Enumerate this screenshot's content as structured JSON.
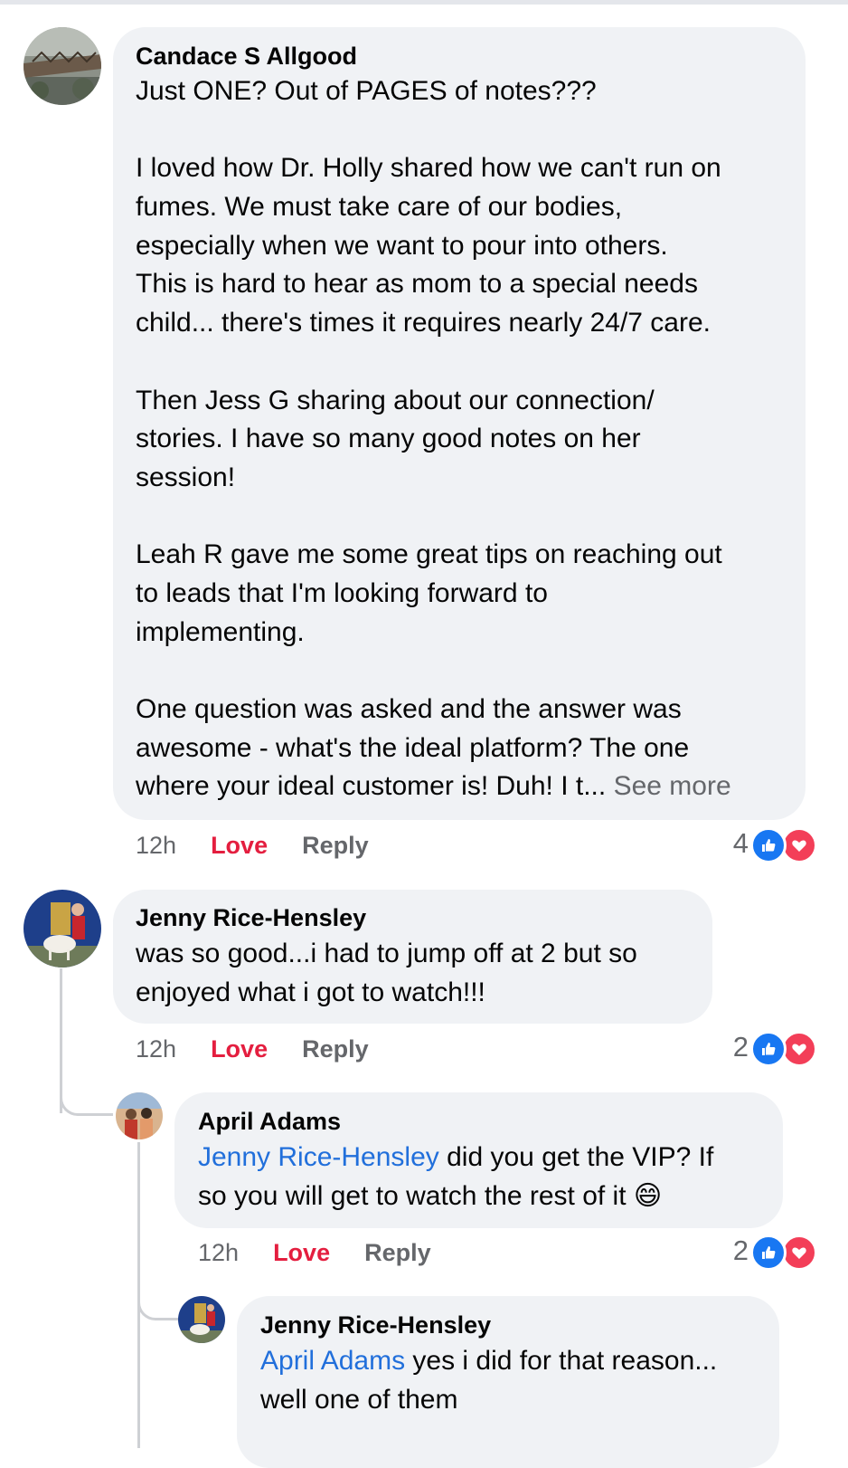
{
  "comments": [
    {
      "author": "Candace S Allgood",
      "lines": [
        "Just ONE? Out of PAGES of notes???",
        "",
        "I loved how Dr. Holly shared how we can't run on",
        "fumes. We must take care of our bodies,",
        "especially when we want to pour into others.",
        "This is hard to hear as mom to a special needs",
        "child... there's times it requires nearly 24/7 care.",
        "",
        "Then Jess G sharing about our connection/",
        "stories. I have so many good notes on her",
        "session!",
        "",
        "Leah R gave me some great tips on reaching out",
        "to leads that I'm looking forward to",
        "implementing.",
        "",
        "One question was asked and the answer was",
        "awesome - what's the ideal platform? The one",
        "where your ideal customer is! Duh! I t..."
      ],
      "see_more": "See more",
      "time": "12h",
      "love": "Love",
      "reply": "Reply",
      "reaction_count": "4"
    },
    {
      "author": "Jenny Rice-Hensley",
      "lines": [
        "was so good...i had to jump off at 2 but so",
        "enjoyed what i got to watch!!!"
      ],
      "time": "12h",
      "love": "Love",
      "reply": "Reply",
      "reaction_count": "2"
    },
    {
      "author": "April Adams",
      "mention": "Jenny Rice-Hensley",
      "line1_rest": " did you get the VIP? If",
      "line2": "so you will get to watch the rest of it ",
      "emoji": "😄",
      "time": "12h",
      "love": "Love",
      "reply": "Reply",
      "reaction_count": "2"
    },
    {
      "author": "Jenny Rice-Hensley",
      "mention": "April Adams",
      "line1_rest": " yes i did for that reason...",
      "line2": "well one of them"
    }
  ],
  "icons": {
    "like": "thumbs-up-icon",
    "love": "heart-icon"
  },
  "colors": {
    "bubble": "#f0f2f5",
    "mention": "#216fdb",
    "love": "#e41e3f",
    "like_badge": "#1877f2",
    "heart_badge": "#f33e58",
    "muted": "#65676b"
  }
}
